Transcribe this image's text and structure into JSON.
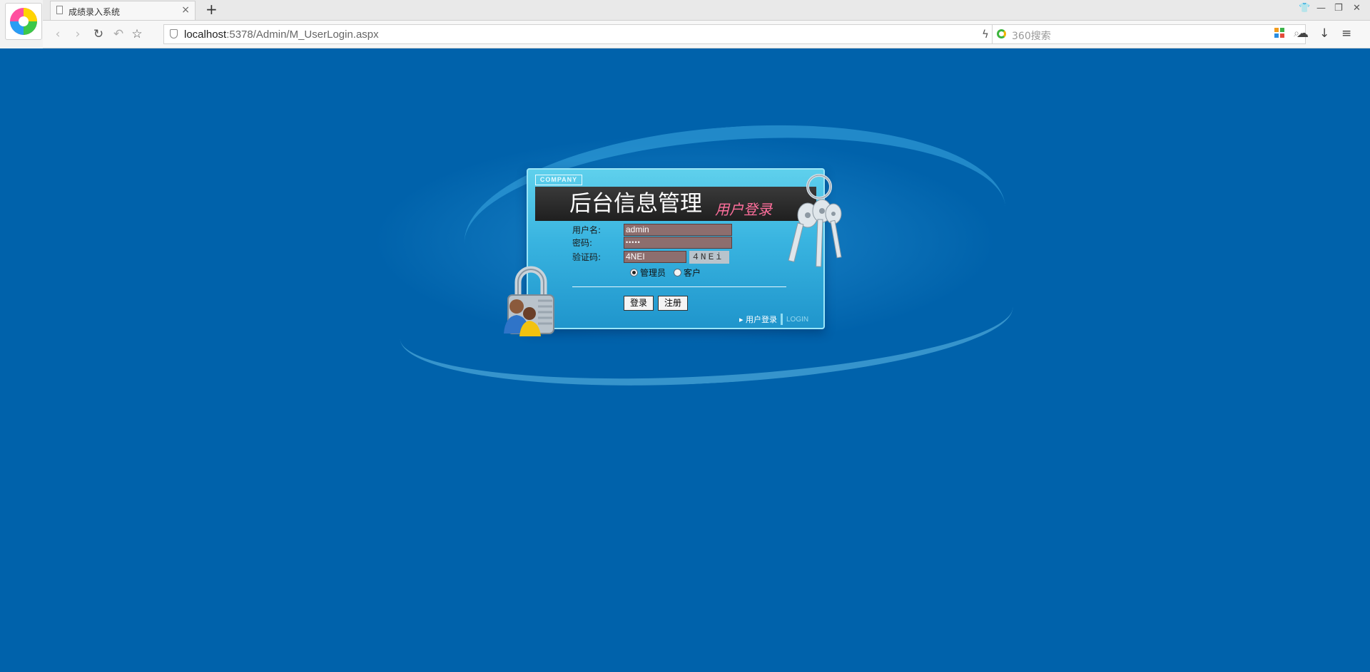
{
  "browser": {
    "tab_title": "成绩录入系统",
    "tab_close": "×",
    "new_tab": "+",
    "url_host": "localhost",
    "url_rest": ":5378/Admin/M_UserLogin.aspx",
    "search_placeholder": "360搜索",
    "window_controls": [
      "❘",
      "—",
      "❐",
      "✕"
    ]
  },
  "login": {
    "company": "COMPANY",
    "title": "后台信息管理",
    "subtitle": "用户登录",
    "username_label": "用户名:",
    "username_value": "admin",
    "password_label": "密码:",
    "password_value": "•••••",
    "captcha_label": "验证码:",
    "captcha_value": "4NEI",
    "captcha_image_text": "4NEi",
    "role_options": [
      {
        "label": "管理员",
        "checked": true
      },
      {
        "label": "客户",
        "checked": false
      }
    ],
    "login_button": "登录",
    "register_button": "注册",
    "footer_link": "▸ 用户登录",
    "footer_login": "LOGIN"
  },
  "colors": {
    "page_background": "#0062ab",
    "panel_gradient_top": "#5fd0ec",
    "title_subtitle": "#ff6f9c",
    "input_background": "#8d6e6e"
  }
}
